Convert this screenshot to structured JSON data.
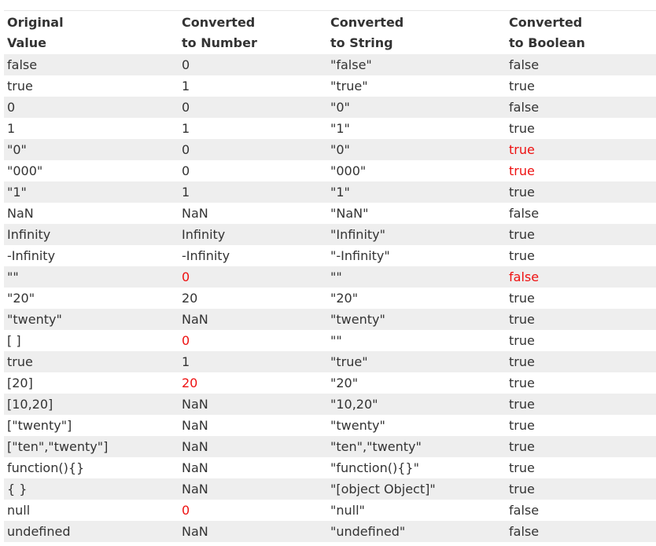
{
  "headers": [
    [
      "Original",
      "Value"
    ],
    [
      "Converted",
      "to Number"
    ],
    [
      "Converted",
      "to String"
    ],
    [
      "Converted",
      "to Boolean"
    ]
  ],
  "highlight_color": "#ee1111",
  "rows": [
    {
      "cells": [
        "false",
        "0",
        "\"false\"",
        "false"
      ],
      "highlight": [
        false,
        false,
        false,
        false
      ]
    },
    {
      "cells": [
        "true",
        "1",
        "\"true\"",
        "true"
      ],
      "highlight": [
        false,
        false,
        false,
        false
      ]
    },
    {
      "cells": [
        "0",
        "0",
        "\"0\"",
        "false"
      ],
      "highlight": [
        false,
        false,
        false,
        false
      ]
    },
    {
      "cells": [
        "1",
        "1",
        "\"1\"",
        "true"
      ],
      "highlight": [
        false,
        false,
        false,
        false
      ]
    },
    {
      "cells": [
        "\"0\"",
        "0",
        "\"0\"",
        "true"
      ],
      "highlight": [
        false,
        false,
        false,
        true
      ]
    },
    {
      "cells": [
        "\"000\"",
        "0",
        "\"000\"",
        "true"
      ],
      "highlight": [
        false,
        false,
        false,
        true
      ]
    },
    {
      "cells": [
        "\"1\"",
        "1",
        "\"1\"",
        "true"
      ],
      "highlight": [
        false,
        false,
        false,
        false
      ]
    },
    {
      "cells": [
        "NaN",
        "NaN",
        "\"NaN\"",
        "false"
      ],
      "highlight": [
        false,
        false,
        false,
        false
      ]
    },
    {
      "cells": [
        "Infinity",
        "Infinity",
        "\"Infinity\"",
        "true"
      ],
      "highlight": [
        false,
        false,
        false,
        false
      ]
    },
    {
      "cells": [
        "-Infinity",
        "-Infinity",
        "\"-Infinity\"",
        "true"
      ],
      "highlight": [
        false,
        false,
        false,
        false
      ]
    },
    {
      "cells": [
        "\"\"",
        "0",
        "\"\"",
        "false"
      ],
      "highlight": [
        false,
        true,
        false,
        true
      ]
    },
    {
      "cells": [
        "\"20\"",
        "20",
        "\"20\"",
        "true"
      ],
      "highlight": [
        false,
        false,
        false,
        false
      ]
    },
    {
      "cells": [
        "\"twenty\"",
        "NaN",
        "\"twenty\"",
        "true"
      ],
      "highlight": [
        false,
        false,
        false,
        false
      ]
    },
    {
      "cells": [
        "[ ]",
        "0",
        "\"\"",
        "true"
      ],
      "highlight": [
        false,
        true,
        false,
        false
      ]
    },
    {
      "cells": [
        "true",
        "1",
        "\"true\"",
        "true"
      ],
      "highlight": [
        false,
        false,
        false,
        false
      ]
    },
    {
      "cells": [
        "[20]",
        "20",
        "\"20\"",
        "true"
      ],
      "highlight": [
        false,
        true,
        false,
        false
      ]
    },
    {
      "cells": [
        "[10,20]",
        "NaN",
        "\"10,20\"",
        "true"
      ],
      "highlight": [
        false,
        false,
        false,
        false
      ]
    },
    {
      "cells": [
        "[\"twenty\"]",
        "NaN",
        "\"twenty\"",
        "true"
      ],
      "highlight": [
        false,
        false,
        false,
        false
      ]
    },
    {
      "cells": [
        "[\"ten\",\"twenty\"]",
        "NaN",
        "\"ten\",\"twenty\"",
        "true"
      ],
      "highlight": [
        false,
        false,
        false,
        false
      ]
    },
    {
      "cells": [
        "function(){}",
        "NaN",
        "\"function(){}\"",
        "true"
      ],
      "highlight": [
        false,
        false,
        false,
        false
      ]
    },
    {
      "cells": [
        "{ }",
        "NaN",
        "\"[object Object]\"",
        "true"
      ],
      "highlight": [
        false,
        false,
        false,
        false
      ]
    },
    {
      "cells": [
        "null",
        "0",
        "\"null\"",
        "false"
      ],
      "highlight": [
        false,
        true,
        false,
        false
      ]
    },
    {
      "cells": [
        "undefined",
        "NaN",
        "\"undefined\"",
        "false"
      ],
      "highlight": [
        false,
        false,
        false,
        false
      ]
    }
  ]
}
